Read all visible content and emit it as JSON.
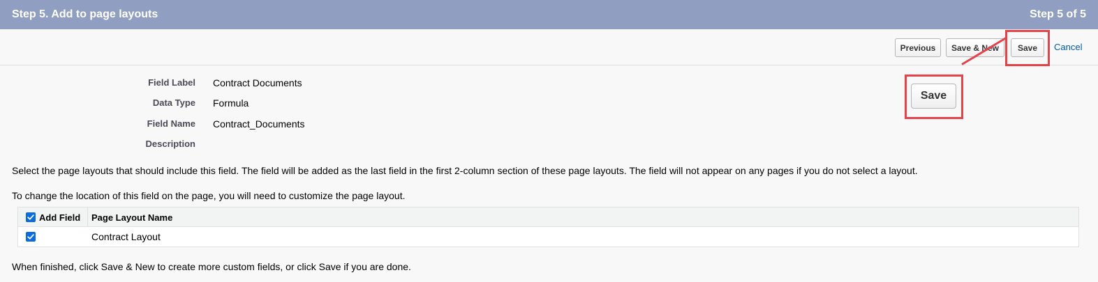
{
  "header": {
    "title": "Step 5. Add to page layouts",
    "step": "Step 5 of 5"
  },
  "toolbar": {
    "previous_label": "Previous",
    "save_new_label": "Save & New",
    "save_label": "Save",
    "cancel_label": "Cancel"
  },
  "callout": {
    "save_label": "Save"
  },
  "details": [
    {
      "label": "Field Label",
      "value": "Contract Documents"
    },
    {
      "label": "Data Type",
      "value": "Formula"
    },
    {
      "label": "Field Name",
      "value": "Contract_Documents"
    },
    {
      "label": "Description",
      "value": ""
    }
  ],
  "instructions": {
    "line1": "Select the page layouts that should include this field. The field will be added as the last field in the first 2-column section of these page layouts. The field will not appear on any pages if you do not select a layout.",
    "line2": "To change the location of this field on the page, you will need to customize the page layout.",
    "finish": "When finished, click Save & New to create more custom fields, or click Save if you are done."
  },
  "table": {
    "headers": {
      "add_field": "Add Field",
      "layout_name": "Page Layout Name"
    },
    "rows": [
      {
        "checked": true,
        "name": "Contract Layout"
      }
    ]
  },
  "colors": {
    "header_bg": "#909fc1",
    "highlight": "#e4434a",
    "checkbox": "#0b6cde",
    "link": "#015ba7"
  }
}
